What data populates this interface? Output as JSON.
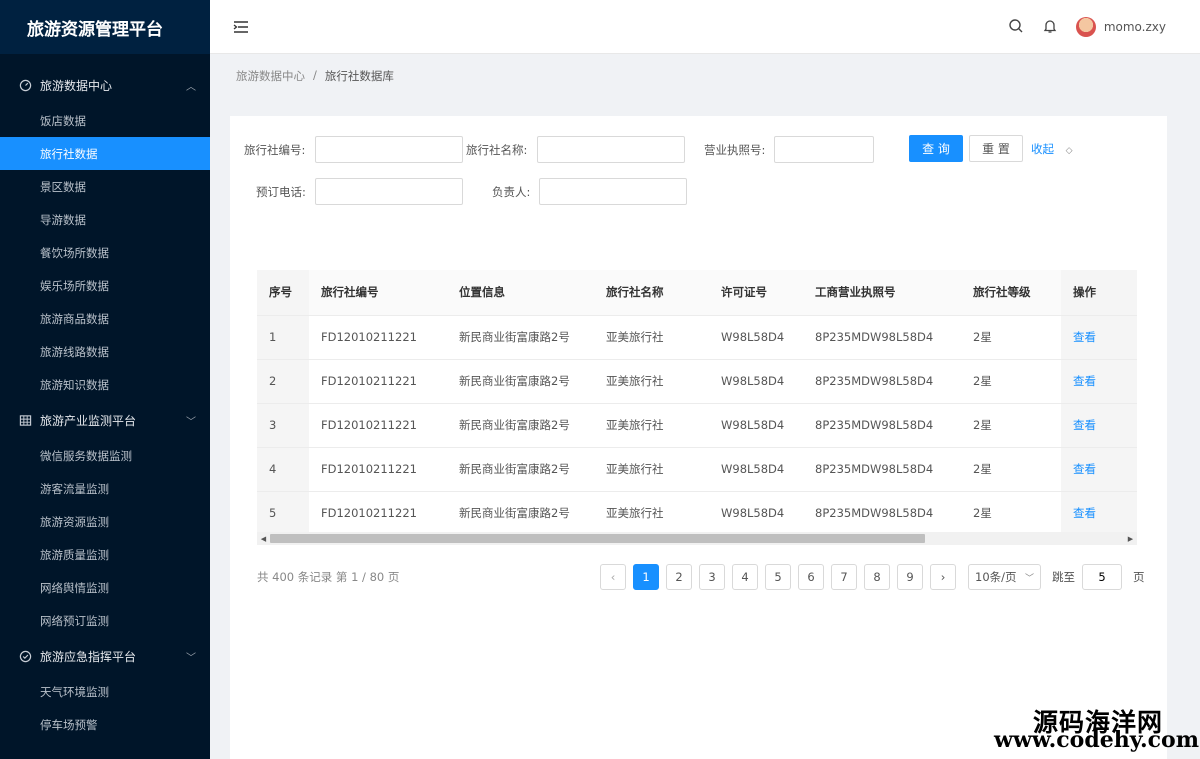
{
  "app": {
    "title": "旅游资源管理平台"
  },
  "sidebar": {
    "groups": [
      {
        "label": "旅游数据中心",
        "icon": "dashboard-icon",
        "expanded": true,
        "items": [
          "饭店数据",
          "旅行社数据",
          "景区数据",
          "导游数据",
          "餐饮场所数据",
          "娱乐场所数据",
          "旅游商品数据",
          "旅游线路数据",
          "旅游知识数据"
        ]
      },
      {
        "label": "旅游产业监测平台",
        "icon": "table-icon",
        "expanded": false,
        "items": [
          "微信服务数据监测",
          "游客流量监测",
          "旅游资源监测",
          "旅游质量监测",
          "网络舆情监测",
          "网络预订监测"
        ]
      },
      {
        "label": "旅游应急指挥平台",
        "icon": "check-circle-icon",
        "expanded": false,
        "items": [
          "天气环境监测",
          "停车场预警"
        ]
      }
    ],
    "active_item": "旅行社数据"
  },
  "header": {
    "username": "momo.zxy"
  },
  "breadcrumb": {
    "parent": "旅游数据中心",
    "separator": "/",
    "current": "旅行社数据库"
  },
  "search_form": {
    "agency_code_label": "旅行社编号:",
    "agency_name_label": "旅行社名称:",
    "license_label": "营业执照号:",
    "phone_label": "预订电话:",
    "manager_label": "负责人:",
    "agency_code_value": "",
    "agency_name_value": "",
    "license_value": "",
    "phone_value": "",
    "manager_value": "",
    "query_label": "查 询",
    "reset_label": "重 置",
    "collapse_label": "收起"
  },
  "table": {
    "columns": [
      "序号",
      "旅行社编号",
      "位置信息",
      "旅行社名称",
      "许可证号",
      "工商营业执照号",
      "旅行社等级",
      "操作"
    ],
    "rows": [
      [
        "1",
        "FD12010211221",
        "新民商业街富康路2号",
        "亚美旅行社",
        "W98L58D4",
        "8P235MDW98L58D4",
        "2星",
        "查看"
      ],
      [
        "2",
        "FD12010211221",
        "新民商业街富康路2号",
        "亚美旅行社",
        "W98L58D4",
        "8P235MDW98L58D4",
        "2星",
        "查看"
      ],
      [
        "3",
        "FD12010211221",
        "新民商业街富康路2号",
        "亚美旅行社",
        "W98L58D4",
        "8P235MDW98L58D4",
        "2星",
        "查看"
      ],
      [
        "4",
        "FD12010211221",
        "新民商业街富康路2号",
        "亚美旅行社",
        "W98L58D4",
        "8P235MDW98L58D4",
        "2星",
        "查看"
      ],
      [
        "5",
        "FD12010211221",
        "新民商业街富康路2号",
        "亚美旅行社",
        "W98L58D4",
        "8P235MDW98L58D4",
        "2星",
        "查看"
      ]
    ]
  },
  "pagination": {
    "summary": "共 400 条记录 第 1 / 80 页",
    "pages": [
      "1",
      "2",
      "3",
      "4",
      "5",
      "6",
      "7",
      "8",
      "9"
    ],
    "current": "1",
    "page_size": "10条/页",
    "jump_label": "跳至",
    "jump_value": "5",
    "page_unit": "页"
  },
  "watermark": {
    "line1": "源码海洋网",
    "line2": "www.codehy.com"
  },
  "colors": {
    "sidebar_bg": "#001529",
    "primary": "#1890ff"
  }
}
